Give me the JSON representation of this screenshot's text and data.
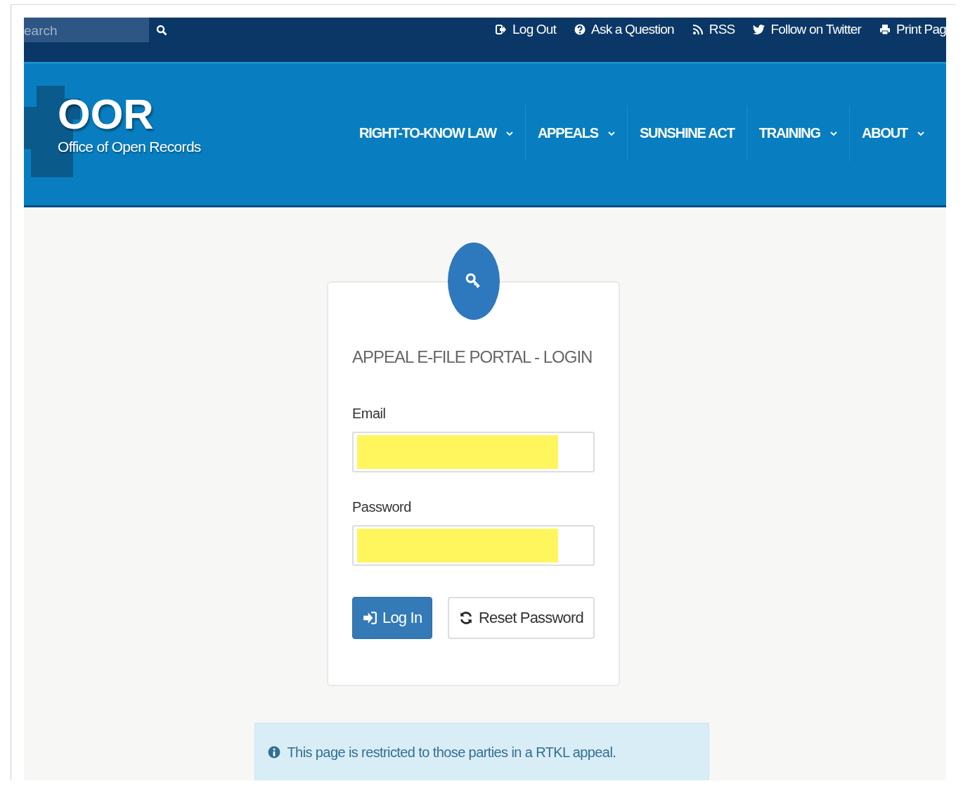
{
  "search": {
    "placeholder": "earch"
  },
  "top_links": [
    {
      "kind": "logout",
      "label": "Log Out"
    },
    {
      "kind": "question",
      "label": "Ask a Question"
    },
    {
      "kind": "rss",
      "label": "RSS"
    },
    {
      "kind": "twitter",
      "label": "Follow on Twitter"
    },
    {
      "kind": "print",
      "label": "Print Pag"
    }
  ],
  "logo": {
    "title": "OOR",
    "subtitle": "Office of Open Records"
  },
  "nav": [
    {
      "label": "RIGHT-TO-KNOW LAW",
      "dropdown": true
    },
    {
      "label": "APPEALS",
      "dropdown": true
    },
    {
      "label": "SUNSHINE ACT",
      "dropdown": false
    },
    {
      "label": "TRAINING",
      "dropdown": true
    },
    {
      "label": "ABOUT",
      "dropdown": true
    }
  ],
  "login": {
    "title": "APPEAL E-FILE PORTAL - LOGIN",
    "fields": [
      {
        "label": "Email",
        "redacted": true
      },
      {
        "label": "Password",
        "redacted": true
      }
    ],
    "buttons": [
      {
        "kind": "primary",
        "label": "Log In"
      },
      {
        "kind": "secondary",
        "label": "Reset Password"
      }
    ]
  },
  "notice": "This page is restricted to those parties in a RTKL appeal."
}
